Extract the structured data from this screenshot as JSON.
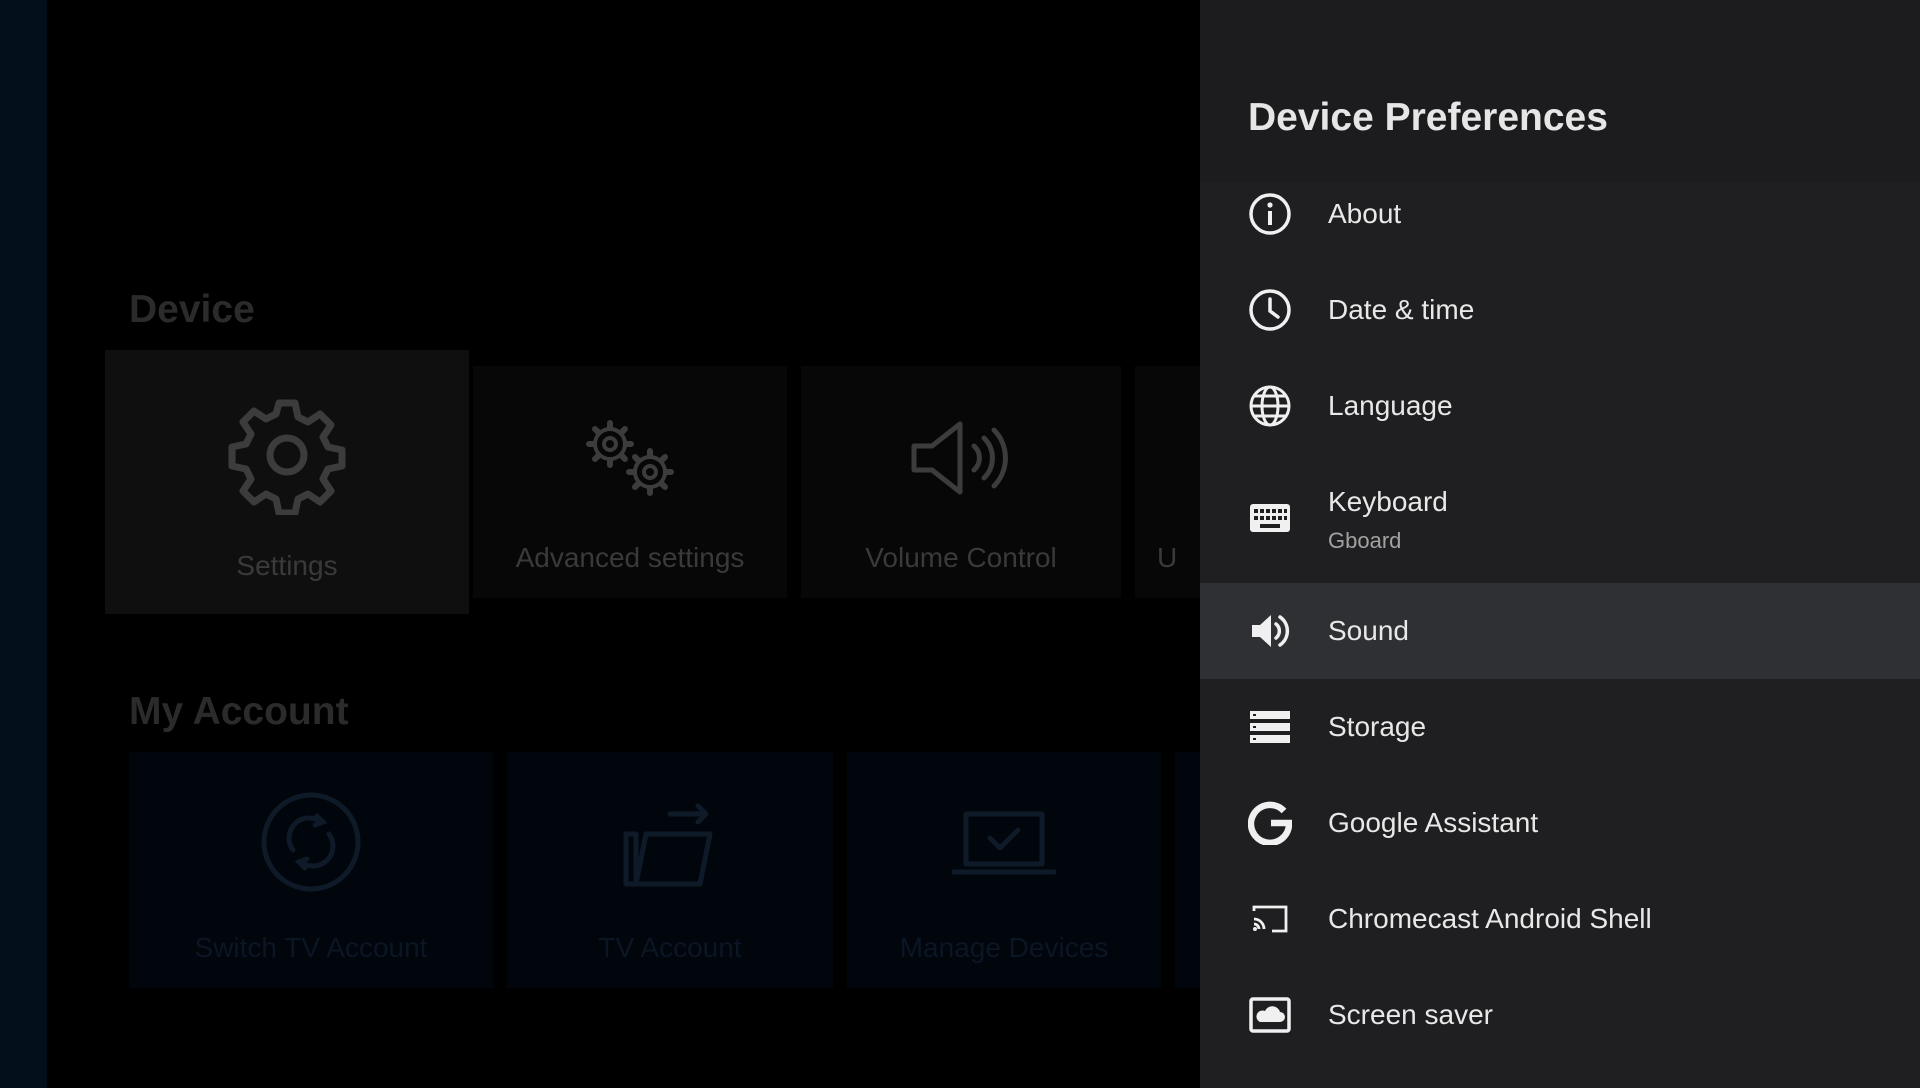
{
  "background": {
    "sections": [
      {
        "title": "Device",
        "tiles": [
          {
            "label": "Settings",
            "icon": "gear-icon"
          },
          {
            "label": "Advanced settings",
            "icon": "gears-icon"
          },
          {
            "label": "Volume Control",
            "icon": "speaker-icon"
          },
          {
            "label": "U",
            "icon": ""
          }
        ]
      },
      {
        "title": "My Account",
        "tiles": [
          {
            "label": "Switch TV Account",
            "icon": "switch-account-icon"
          },
          {
            "label": "TV Account",
            "icon": "tv-account-icon"
          },
          {
            "label": "Manage Devices",
            "icon": "laptop-check-icon"
          }
        ]
      }
    ]
  },
  "panel": {
    "title": "Device Preferences",
    "items": [
      {
        "label": "About",
        "icon": "info-icon"
      },
      {
        "label": "Date & time",
        "icon": "clock-icon"
      },
      {
        "label": "Language",
        "icon": "globe-icon"
      },
      {
        "label": "Keyboard",
        "sublabel": "Gboard",
        "icon": "keyboard-icon"
      },
      {
        "label": "Sound",
        "icon": "volume-icon",
        "focused": true
      },
      {
        "label": "Storage",
        "icon": "storage-icon"
      },
      {
        "label": "Google Assistant",
        "icon": "google-icon"
      },
      {
        "label": "Chromecast Android Shell",
        "icon": "cast-icon"
      },
      {
        "label": "Screen saver",
        "icon": "screen-saver-icon"
      }
    ]
  },
  "colors": {
    "panel_bg": "#1f1f21",
    "focused_row": "#2f3033",
    "text_primary": "#e8e8e8",
    "text_secondary": "#a2a2a2"
  }
}
